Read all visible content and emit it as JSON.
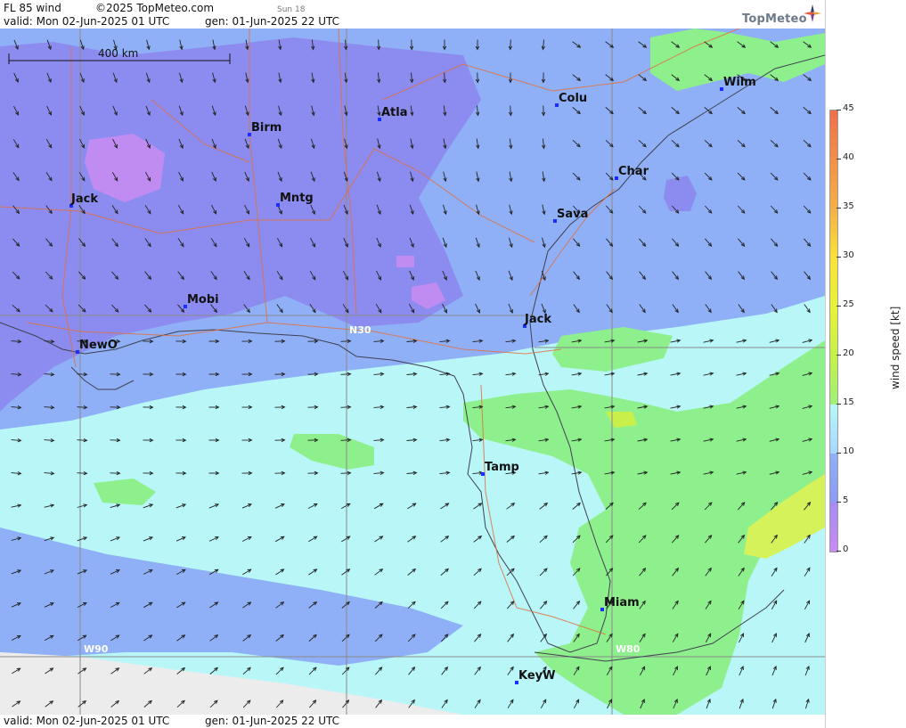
{
  "header": {
    "product": "FL 85 wind",
    "copyright": "©2025 TopMeteo.com",
    "sun": "Sun 18",
    "valid": "valid:  Mon  02-Jun-2025  01 UTC",
    "gen": "gen: 01-Jun-2025 22 UTC",
    "logo_text": "TopMeteo"
  },
  "footer": {
    "valid": "valid:  Mon  02-Jun-2025  01 UTC",
    "gen": "gen: 01-Jun-2025 22 UTC"
  },
  "map": {
    "scale_label": "400 km",
    "lat_label": "N30",
    "lon_labels": [
      "W90",
      "W80"
    ],
    "cities": [
      {
        "name": "Birm"
      },
      {
        "name": "Atla"
      },
      {
        "name": "Colu"
      },
      {
        "name": "Wilm"
      },
      {
        "name": "Char"
      },
      {
        "name": "Sava"
      },
      {
        "name": "Jack"
      },
      {
        "name": "Mntg"
      },
      {
        "name": "Mobi"
      },
      {
        "name": "NewO"
      },
      {
        "name": "Jack"
      },
      {
        "name": "Tamp"
      },
      {
        "name": "Miam"
      },
      {
        "name": "KeyW"
      }
    ]
  },
  "legend": {
    "label": "wind speed [kt]",
    "ticks": [
      "45",
      "40",
      "35",
      "30",
      "25",
      "20",
      "15",
      "10",
      "5",
      "0"
    ],
    "colors": {
      "calm": "#c98bf2",
      "light": "#8c9bf2",
      "moderate": "#a6d8ff",
      "fresh": "#b8f6f8",
      "strong": "#9ff07a",
      "gale": "#e8f23a",
      "storm": "#ee6f4c"
    }
  }
}
